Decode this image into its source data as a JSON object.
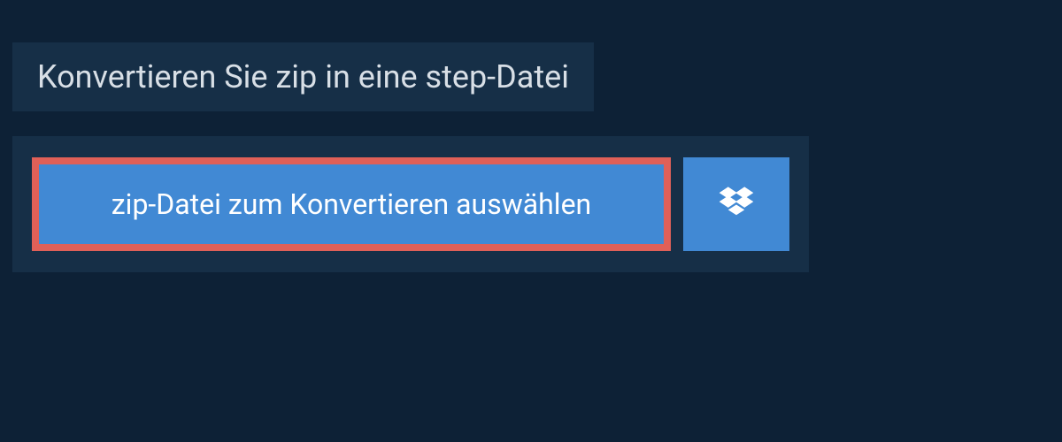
{
  "header": {
    "title": "Konvertieren Sie zip in eine step-Datei"
  },
  "actions": {
    "select_file_label": "zip-Datei zum Konvertieren auswählen"
  },
  "colors": {
    "background": "#0d2136",
    "panel": "#162f47",
    "button": "#4189d4",
    "highlight_border": "#e06058",
    "text_light": "#d8dfe6",
    "text_white": "#ffffff"
  }
}
